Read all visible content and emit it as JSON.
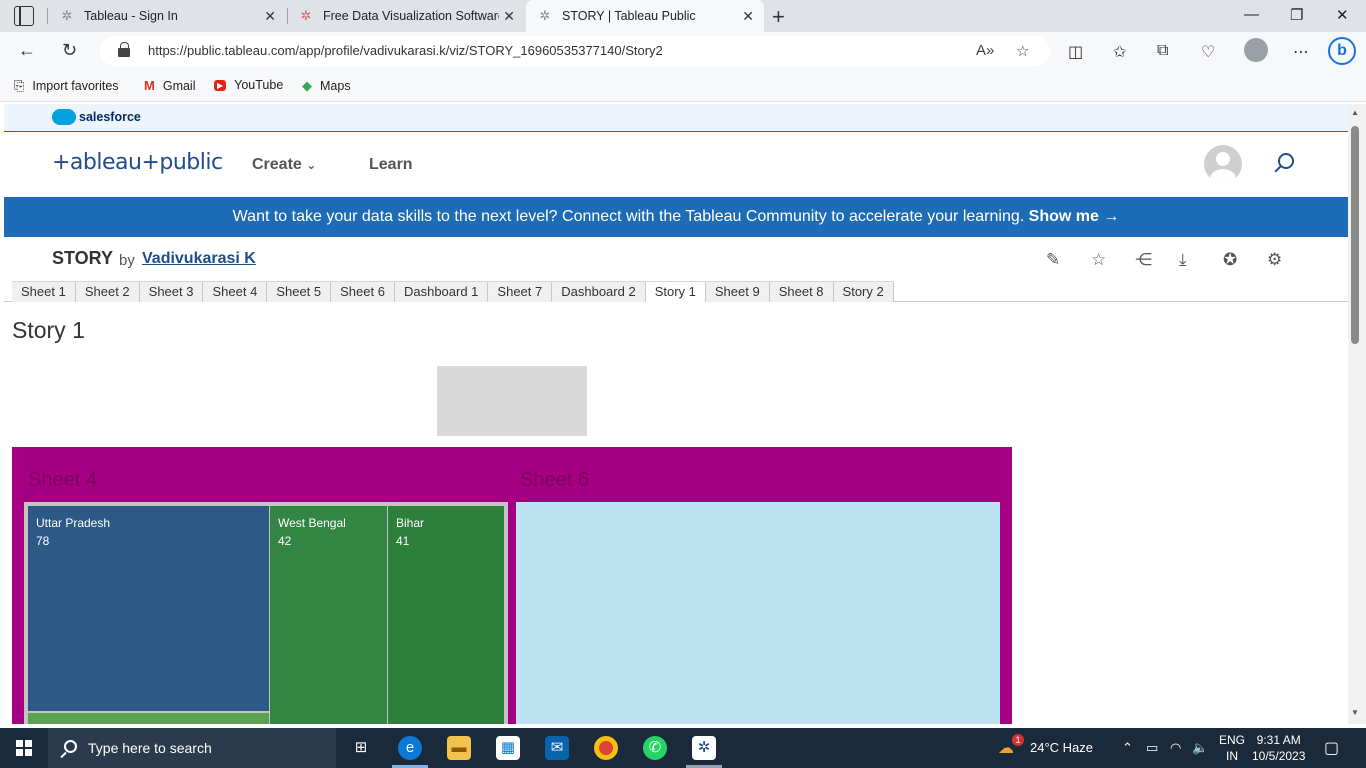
{
  "browser": {
    "tabs": [
      {
        "title": "Tableau - Sign In",
        "active": false
      },
      {
        "title": "Free Data Visualization Software",
        "active": false
      },
      {
        "title": "STORY | Tableau Public",
        "active": true
      }
    ],
    "url": "https://public.tableau.com/app/profile/vadivukarasi.k/viz/STORY_16960535377140/Story2",
    "favorites": [
      "Import favorites",
      "Gmail",
      "YouTube",
      "Maps"
    ]
  },
  "salesforce": {
    "label": "salesforce"
  },
  "header": {
    "logo": "+ableau+public",
    "nav": [
      "Create",
      "Learn"
    ]
  },
  "banner": {
    "text": "Want to take your data skills to the next level? Connect with the Tableau Community to accelerate your learning.",
    "link": "Show me →"
  },
  "viz": {
    "title": "STORY",
    "by": "by",
    "author": "Vadivukarasi K"
  },
  "sheet_tabs": [
    "Sheet 1",
    "Sheet 2",
    "Sheet 3",
    "Sheet 4",
    "Sheet 5",
    "Sheet 6",
    "Dashboard 1",
    "Sheet 7",
    "Dashboard 2",
    "Story 1",
    "Sheet 9",
    "Sheet 8",
    "Story 2"
  ],
  "active_sheet_tab": "Story 1",
  "story": {
    "title": "Story 1",
    "sheet4_title": "Sheet 4",
    "sheet6_title": "Sheet 6",
    "treemap": [
      {
        "label": "Uttar Pradesh",
        "value": "78",
        "color": "#2c5986"
      },
      {
        "label": "West Bengal",
        "value": "42",
        "color": "#338543"
      },
      {
        "label": "Bihar",
        "value": "41",
        "color": "#2e7e3c"
      }
    ],
    "dashboard_color": "#a50082",
    "sheet6_color": "#bde3f1"
  },
  "taskbar": {
    "search_placeholder": "Type here to search",
    "weather": "24°C  Haze",
    "weather_badge": "1",
    "lang_top": "ENG",
    "lang_bottom": "IN",
    "time": "9:31 AM",
    "date": "10/5/2023"
  }
}
